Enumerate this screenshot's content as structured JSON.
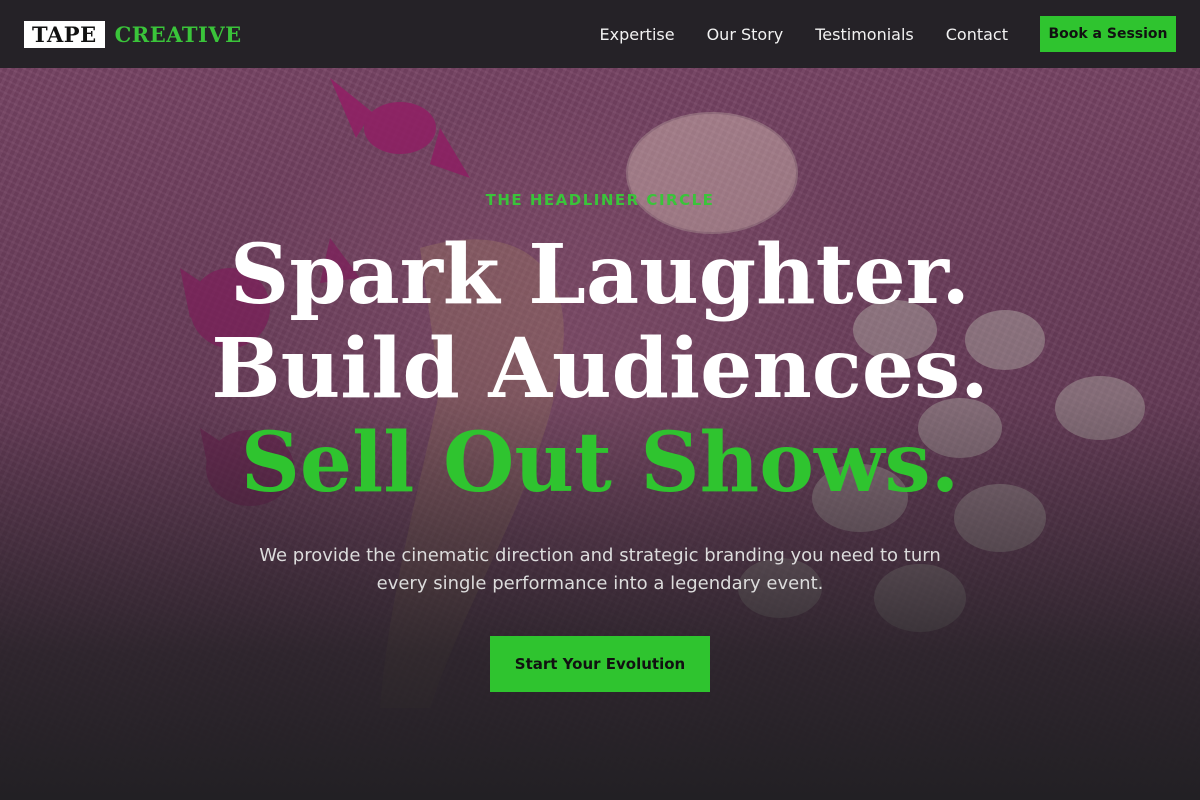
{
  "brand": {
    "box_text": "TAPE",
    "word_text": "CREATIVE",
    "accent_color": "#2fc42f"
  },
  "nav": {
    "items": [
      {
        "label": "Expertise"
      },
      {
        "label": "Our Story"
      },
      {
        "label": "Testimonials"
      },
      {
        "label": "Contact"
      }
    ],
    "cta_label": "Book a Session"
  },
  "hero": {
    "eyebrow": "THE HEADLINER CIRCLE",
    "headline_1": "Spark Laughter.",
    "headline_2": "Build Audiences.",
    "headline_3": "Sell Out Shows.",
    "subtext": "We provide the cinematic direction and strategic branding you need to turn every single performance into a legendary event.",
    "cta_label": "Start Your Evolution",
    "background_image": "pink-fur-with-candies-and-petals-photo"
  }
}
